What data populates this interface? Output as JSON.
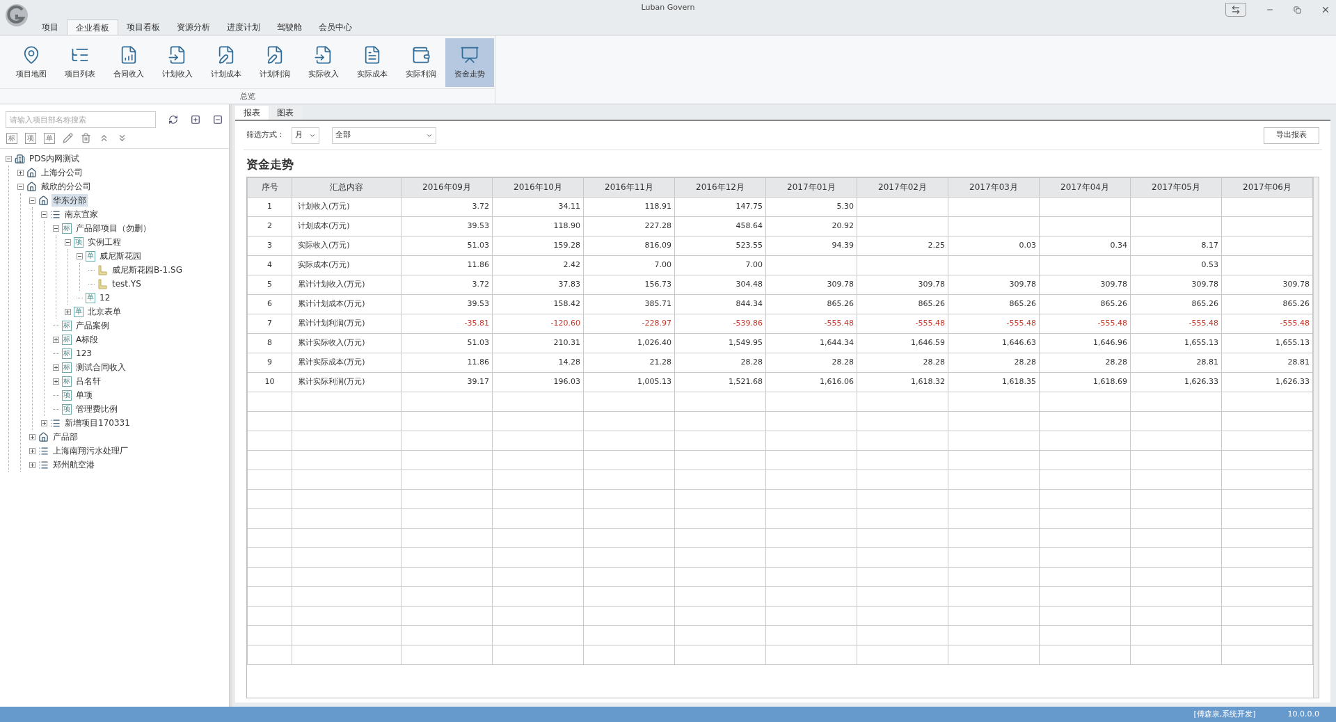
{
  "window": {
    "title": "Luban Govern"
  },
  "menu_tabs": [
    {
      "label": "项目",
      "selected": false
    },
    {
      "label": "企业看板",
      "selected": true
    },
    {
      "label": "项目看板",
      "selected": false
    },
    {
      "label": "资源分析",
      "selected": false
    },
    {
      "label": "进度计划",
      "selected": false
    },
    {
      "label": "驾驶舱",
      "selected": false
    },
    {
      "label": "会员中心",
      "selected": false
    }
  ],
  "ribbon": {
    "group": "总览",
    "buttons": [
      {
        "label": "项目地图",
        "kind": "map",
        "selected": false
      },
      {
        "label": "项目列表",
        "kind": "list",
        "selected": false
      },
      {
        "label": "合同收入",
        "kind": "chart",
        "selected": false
      },
      {
        "label": "计划收入",
        "kind": "income",
        "selected": false
      },
      {
        "label": "计划成本",
        "kind": "edit",
        "selected": false
      },
      {
        "label": "计划利润",
        "kind": "edit",
        "selected": false
      },
      {
        "label": "实际收入",
        "kind": "income",
        "selected": false
      },
      {
        "label": "实际成本",
        "kind": "doc",
        "selected": false
      },
      {
        "label": "实际利润",
        "kind": "bag",
        "selected": false
      },
      {
        "label": "资金走势",
        "kind": "trend",
        "selected": true
      }
    ]
  },
  "sidebar": {
    "search": {
      "placeholder": "请输入项目部名称搜索"
    },
    "tools": [
      {
        "kind": "add",
        "glyph": "标"
      },
      {
        "kind": "add",
        "glyph": "项"
      },
      {
        "kind": "add",
        "glyph": "单"
      },
      {
        "kind": "edit"
      },
      {
        "kind": "delete"
      },
      {
        "kind": "up"
      },
      {
        "kind": "down"
      }
    ],
    "tree": [
      {
        "label": "PDS内网测试",
        "kind": "company",
        "expanded": true,
        "selected": false,
        "children": [
          {
            "label": "上海分公司",
            "kind": "branch",
            "expanded": false,
            "selected": false
          },
          {
            "label": "戴欣的分公司",
            "kind": "branch",
            "expanded": true,
            "selected": false,
            "children": [
              {
                "label": "华东分部",
                "kind": "branch",
                "expanded": true,
                "selected": true,
                "children": [
                  {
                    "label": "南京宜家",
                    "kind": "project",
                    "expanded": true,
                    "selected": false,
                    "children": [
                      {
                        "label": "产品部项目（勿删）",
                        "kind": "badge",
                        "badge": "标",
                        "expanded": true,
                        "selected": false,
                        "children": [
                          {
                            "label": "实例工程",
                            "kind": "badge",
                            "badge": "项",
                            "expanded": true,
                            "selected": false,
                            "children": [
                              {
                                "label": "威尼斯花园",
                                "kind": "badge",
                                "badge": "单",
                                "expanded": true,
                                "selected": false,
                                "children": [
                                  {
                                    "label": "威尼斯花园B-1.SG",
                                    "kind": "file",
                                    "selected": false
                                  },
                                  {
                                    "label": "test.YS",
                                    "kind": "file",
                                    "selected": false
                                  }
                                ]
                              },
                              {
                                "label": "12",
                                "kind": "badge",
                                "badge": "单",
                                "selected": false
                              }
                            ]
                          },
                          {
                            "label": "北京表单",
                            "kind": "badge",
                            "badge": "单",
                            "expanded": false,
                            "selected": false
                          }
                        ]
                      },
                      {
                        "label": "产品案例",
                        "kind": "badge",
                        "badge": "标",
                        "selected": false
                      },
                      {
                        "label": "A标段",
                        "kind": "badge",
                        "badge": "标",
                        "expanded": false,
                        "selected": false
                      },
                      {
                        "label": "123",
                        "kind": "badge",
                        "badge": "标",
                        "selected": false
                      },
                      {
                        "label": "测试合同收入",
                        "kind": "badge",
                        "badge": "标",
                        "expanded": false,
                        "selected": false
                      },
                      {
                        "label": "吕名轩",
                        "kind": "badge",
                        "badge": "标",
                        "expanded": false,
                        "selected": false
                      },
                      {
                        "label": "单项",
                        "kind": "badge",
                        "badge": "项",
                        "selected": false
                      },
                      {
                        "label": "管理费比例",
                        "kind": "badge",
                        "badge": "项",
                        "selected": false
                      }
                    ]
                  },
                  {
                    "label": "新增项目170331",
                    "kind": "project",
                    "expanded": false,
                    "selected": false
                  }
                ]
              },
              {
                "label": "产品部",
                "kind": "branch",
                "expanded": false,
                "selected": false
              },
              {
                "label": "上海南翔污水处理厂",
                "kind": "project",
                "expanded": false,
                "selected": false
              },
              {
                "label": "郑州航空港",
                "kind": "project",
                "expanded": false,
                "selected": false
              }
            ]
          }
        ]
      }
    ]
  },
  "view_tabs": [
    {
      "label": "报表",
      "selected": true
    },
    {
      "label": "图表",
      "selected": false
    }
  ],
  "filter": {
    "label": "筛选方式：",
    "period": "月",
    "scope": "全部",
    "export_button": "导出报表"
  },
  "report": {
    "title": "资金走势",
    "columns": [
      "序号",
      "汇总内容",
      "2016年09月",
      "2016年10月",
      "2016年11月",
      "2016年12月",
      "2017年01月",
      "2017年02月",
      "2017年03月",
      "2017年04月",
      "2017年05月",
      "2017年06月"
    ],
    "rows": [
      {
        "no": "1",
        "item": "计划收入(万元)",
        "negative": false,
        "cells": {
          "m1": "3.72",
          "m2": "34.11",
          "m3": "118.91",
          "m4": "147.75",
          "m5": "5.30"
        }
      },
      {
        "no": "2",
        "item": "计划成本(万元)",
        "negative": false,
        "cells": {
          "m1": "39.53",
          "m2": "118.90",
          "m3": "227.28",
          "m4": "458.64",
          "m5": "20.92"
        }
      },
      {
        "no": "3",
        "item": "实际收入(万元)",
        "negative": false,
        "cells": {
          "m1": "51.03",
          "m2": "159.28",
          "m3": "816.09",
          "m4": "523.55",
          "m5": "94.39",
          "m6": "2.25",
          "m7": "0.03",
          "m8": "0.34",
          "m9": "8.17"
        }
      },
      {
        "no": "4",
        "item": "实际成本(万元)",
        "negative": false,
        "cells": {
          "m1": "11.86",
          "m2": "2.42",
          "m3": "7.00",
          "m4": "7.00",
          "m9": "0.53"
        }
      },
      {
        "no": "5",
        "item": "累计计划收入(万元)",
        "negative": false,
        "cells": {
          "m1": "3.72",
          "m2": "37.83",
          "m3": "156.73",
          "m4": "304.48",
          "m5": "309.78",
          "m6": "309.78",
          "m7": "309.78",
          "m8": "309.78",
          "m9": "309.78",
          "m10": "309.78"
        }
      },
      {
        "no": "6",
        "item": "累计计划成本(万元)",
        "negative": false,
        "cells": {
          "m1": "39.53",
          "m2": "158.42",
          "m3": "385.71",
          "m4": "844.34",
          "m5": "865.26",
          "m6": "865.26",
          "m7": "865.26",
          "m8": "865.26",
          "m9": "865.26",
          "m10": "865.26"
        }
      },
      {
        "no": "7",
        "item": "累计计划利润(万元)",
        "negative": true,
        "cells": {
          "m1": "-35.81",
          "m2": "-120.60",
          "m3": "-228.97",
          "m4": "-539.86",
          "m5": "-555.48",
          "m6": "-555.48",
          "m7": "-555.48",
          "m8": "-555.48",
          "m9": "-555.48",
          "m10": "-555.48"
        }
      },
      {
        "no": "8",
        "item": "累计实际收入(万元)",
        "negative": false,
        "cells": {
          "m1": "51.03",
          "m2": "210.31",
          "m3": "1,026.40",
          "m4": "1,549.95",
          "m5": "1,644.34",
          "m6": "1,646.59",
          "m7": "1,646.63",
          "m8": "1,646.96",
          "m9": "1,655.13",
          "m10": "1,655.13"
        }
      },
      {
        "no": "9",
        "item": "累计实际成本(万元)",
        "negative": false,
        "cells": {
          "m1": "11.86",
          "m2": "14.28",
          "m3": "21.28",
          "m4": "28.28",
          "m5": "28.28",
          "m6": "28.28",
          "m7": "28.28",
          "m8": "28.28",
          "m9": "28.81",
          "m10": "28.81"
        }
      },
      {
        "no": "10",
        "item": "累计实际利润(万元)",
        "negative": false,
        "cells": {
          "m1": "39.17",
          "m2": "196.03",
          "m3": "1,005.13",
          "m4": "1,521.68",
          "m5": "1,616.06",
          "m6": "1,618.32",
          "m7": "1,618.35",
          "m8": "1,618.69",
          "m9": "1,626.33",
          "m10": "1,626.33"
        }
      }
    ]
  },
  "status_bar": {
    "user": "[傅森泉,系统开发]",
    "version": "10.0.0.0"
  }
}
